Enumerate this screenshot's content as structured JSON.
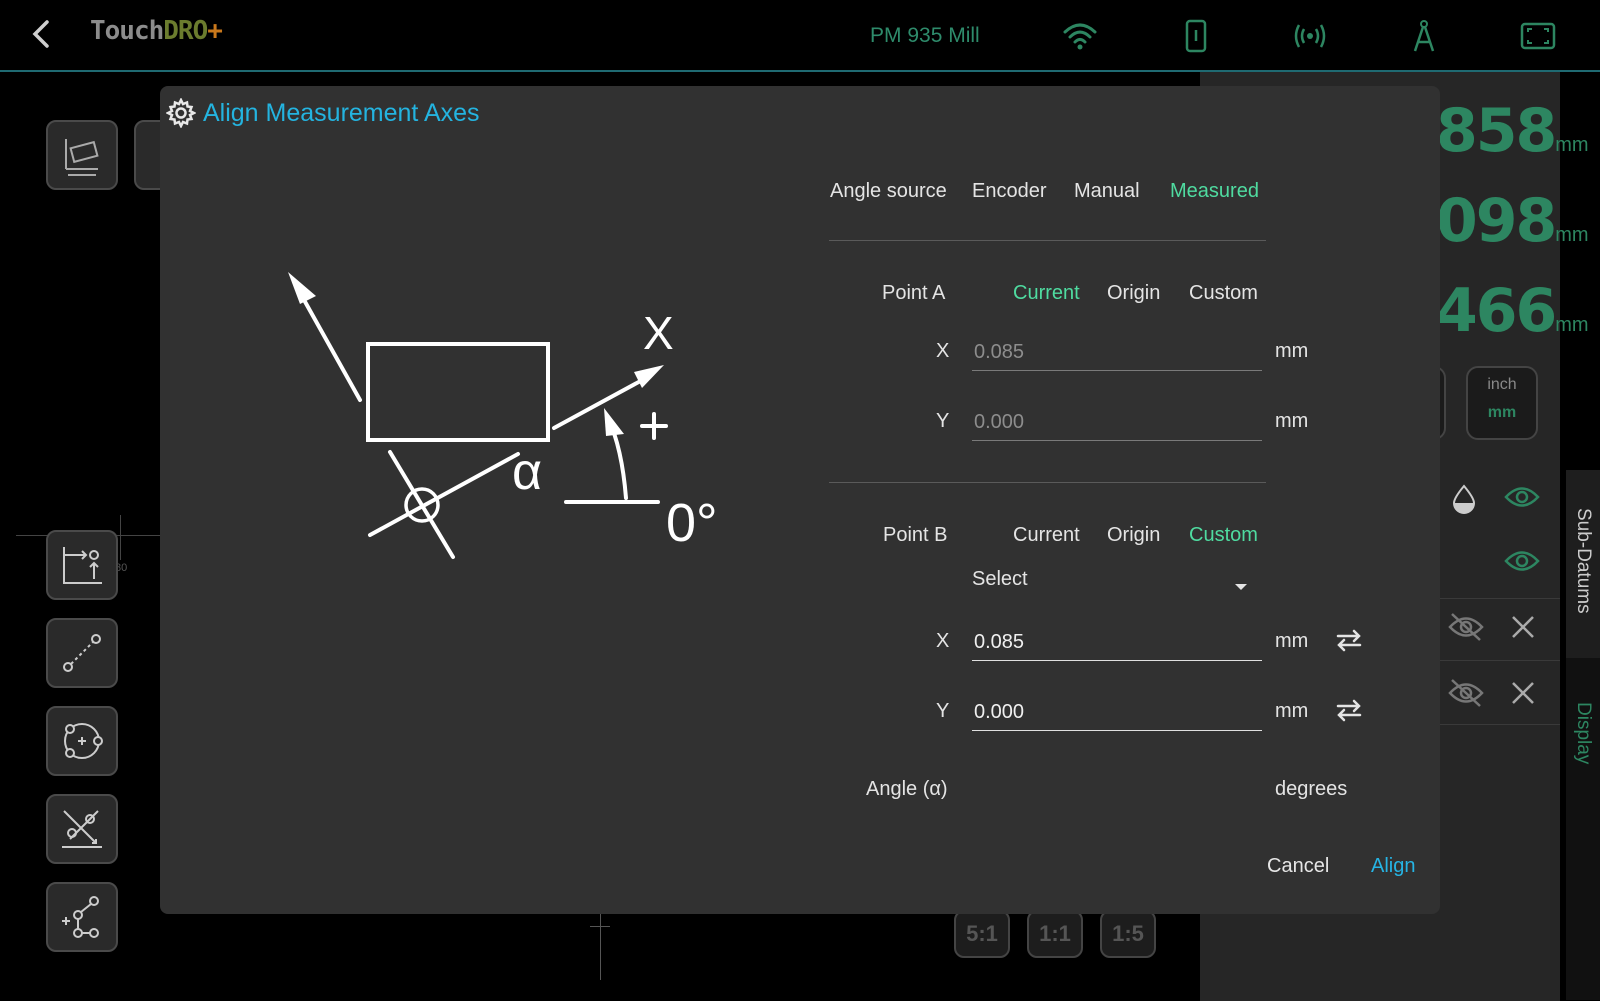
{
  "topbar": {
    "logo_main": "Touch",
    "logo_accent": "DRO",
    "logo_plus": "+",
    "machine_name": "PM 935 Mill",
    "icons": [
      "back-icon",
      "wifi-icon",
      "tablet-icon",
      "broadcast-icon",
      "compass-icon",
      "fullscreen-icon"
    ]
  },
  "readouts": [
    {
      "value": "858",
      "unit": "mm"
    },
    {
      "value": "098",
      "unit": "mm"
    },
    {
      "value": "466",
      "unit": "mm"
    }
  ],
  "units_toggle": {
    "option_a": "inch",
    "option_b": "mm"
  },
  "vertical_tabs": {
    "sub_datums": "Sub-Datums",
    "display": "Display"
  },
  "zoom": [
    "5:1",
    "1:1",
    "1:5"
  ],
  "axis_tick_label": "80",
  "dialog": {
    "title": "Align Measurement Axes",
    "diagram": {
      "axis_label": "X",
      "plus_label": "+",
      "alpha_label": "α",
      "zero_label": "0°"
    },
    "angle_source": {
      "label": "Angle source",
      "options": [
        "Encoder",
        "Manual",
        "Measured"
      ],
      "selected": "Measured"
    },
    "point_a": {
      "label": "Point A",
      "options": [
        "Current",
        "Origin",
        "Custom"
      ],
      "selected": "Current",
      "x_label": "X",
      "x_value": "0.085",
      "x_unit": "mm",
      "y_label": "Y",
      "y_value": "0.000",
      "y_unit": "mm"
    },
    "point_b": {
      "label": "Point B",
      "options": [
        "Current",
        "Origin",
        "Custom"
      ],
      "selected": "Custom",
      "select_value": "Select",
      "x_label": "X",
      "x_value": "0.085",
      "x_unit": "mm",
      "y_label": "Y",
      "y_value": "0.000",
      "y_unit": "mm"
    },
    "angle": {
      "label": "Angle (α)",
      "unit": "degrees"
    },
    "cancel_label": "Cancel",
    "align_label": "Align"
  },
  "colors": {
    "accent_blue": "#24b4e0",
    "selected_green": "#4fdba0",
    "readout_green": "#2d8661"
  }
}
